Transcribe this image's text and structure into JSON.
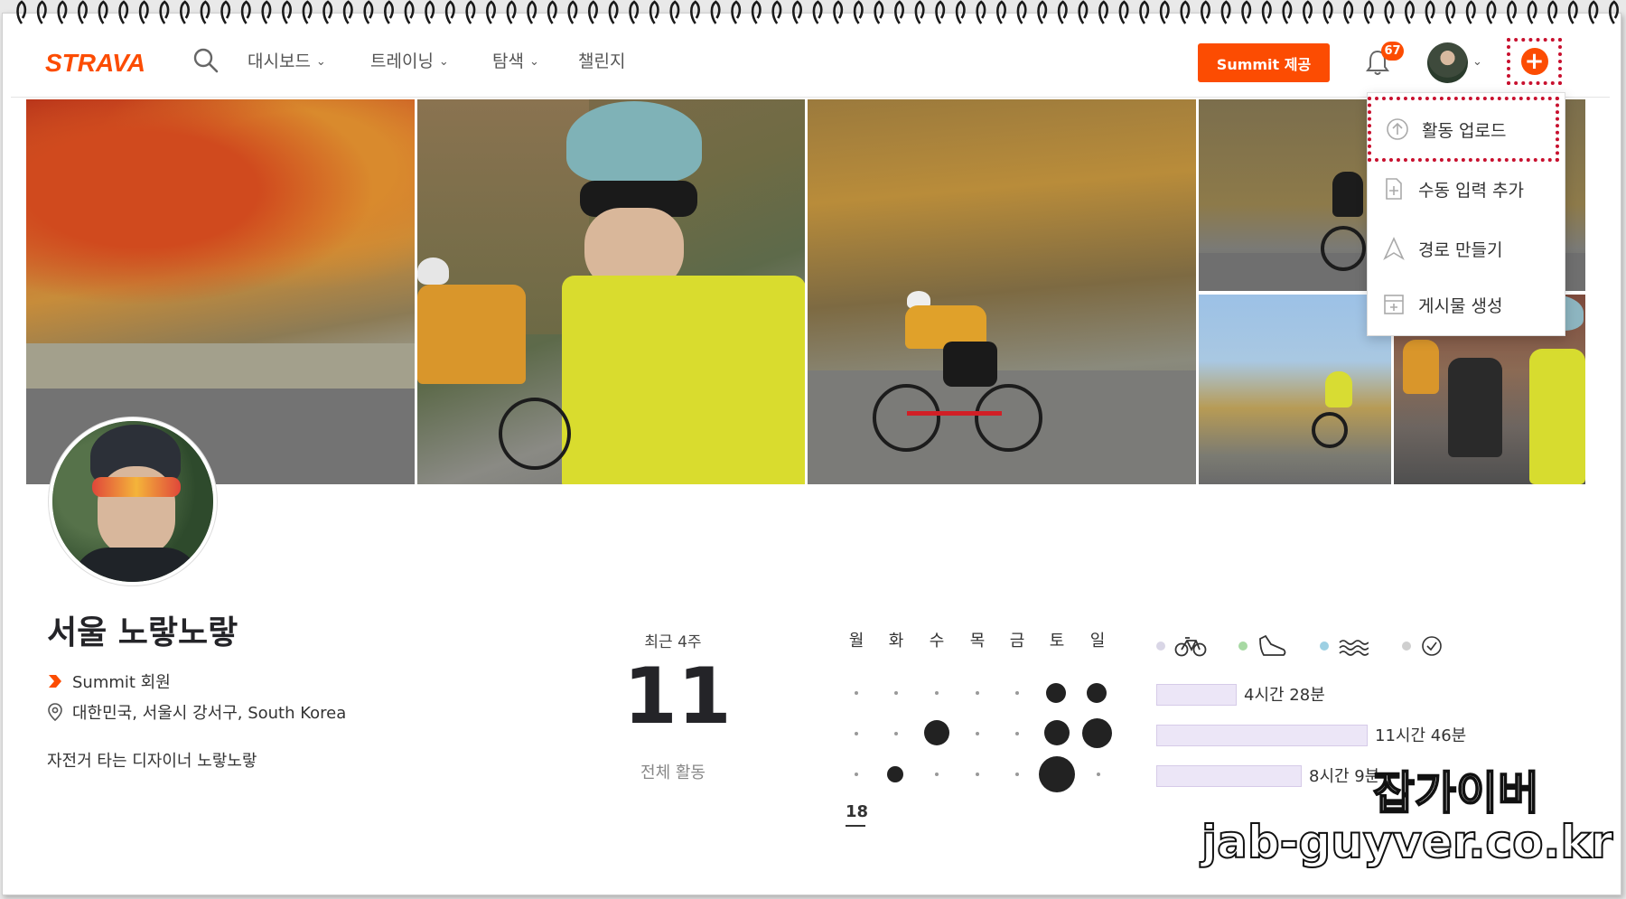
{
  "brand": {
    "logo_text": "STRAVA",
    "color": "#fc4c02"
  },
  "nav": {
    "items": [
      {
        "label": "대시보드"
      },
      {
        "label": "트레이닝"
      },
      {
        "label": "탐색"
      },
      {
        "label": "챌린지"
      }
    ],
    "summit_button": "Summit 제공",
    "notifications_count": "67",
    "search_icon": "search-icon",
    "bell_icon": "bell-icon",
    "plus_icon": "plus-icon"
  },
  "dropdown": {
    "items": [
      {
        "label": "활동 업로드",
        "icon": "upload-icon",
        "highlighted": true
      },
      {
        "label": "수동 입력 추가",
        "icon": "manual-entry-icon"
      },
      {
        "label": "경로 만들기",
        "icon": "route-icon"
      },
      {
        "label": "게시물 생성",
        "icon": "post-icon"
      }
    ]
  },
  "profile": {
    "name": "서울 노랗노랗",
    "membership": "Summit 회원",
    "location": "대한민국, 서울시 강서구, South Korea",
    "bio": "자전거 타는 디자이너 노랗노랗"
  },
  "stats": {
    "recent_label": "최근 4주",
    "total_count": "11",
    "total_label": "전체 활동",
    "weekdays": [
      "월",
      "화",
      "수",
      "목",
      "금",
      "토",
      "일"
    ],
    "current_week": "18",
    "sports": [
      {
        "icon": "bike-icon",
        "color": "#c9c6d8"
      },
      {
        "icon": "run-icon",
        "color": "#9bd39b"
      },
      {
        "icon": "swim-icon",
        "color": "#8ecae6"
      },
      {
        "icon": "time-icon",
        "color": "#cccccc"
      }
    ],
    "weekly_durations": [
      {
        "label": "4시간 28분",
        "ratio": 0.38
      },
      {
        "label": "11시간 46분",
        "ratio": 1.0
      },
      {
        "label": "8시간 9분",
        "ratio": 0.69
      }
    ]
  },
  "watermark": {
    "line1": "잡가이버",
    "line2": "jab-guyver.co.kr"
  }
}
